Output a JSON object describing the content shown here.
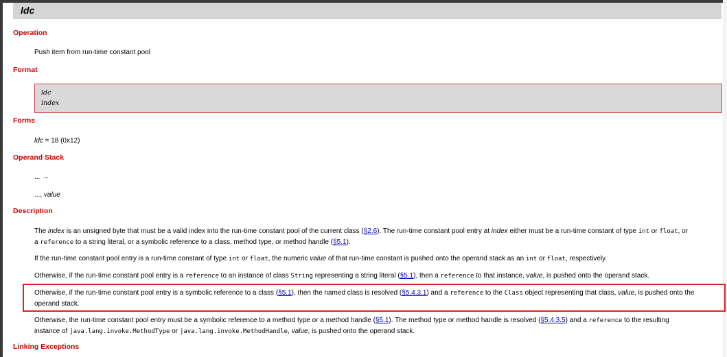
{
  "title": "ldc",
  "operation": {
    "heading": "Operation",
    "text": "Push item from run-time constant pool"
  },
  "format": {
    "heading": "Format",
    "lines": [
      "ldc",
      "index"
    ]
  },
  "forms": {
    "heading": "Forms",
    "name": "ldc",
    "value": " = 18 (0x12)"
  },
  "operand_stack": {
    "heading": "Operand Stack",
    "before": "... →",
    "after_prefix": "..., ",
    "after_value": "value"
  },
  "description": {
    "heading": "Description",
    "p1": {
      "t1": "The ",
      "index": "index",
      "t2": " is an unsigned byte that must be a valid index into the run-time constant pool of the current class (",
      "link1": "§2.6",
      "t3": "). The run-time constant pool entry at ",
      "index2": "index",
      "t4": " either must be a run-time constant of type ",
      "int": "int",
      "t5": " or ",
      "float": "float",
      "t6": ", or",
      "t7": "a ",
      "reference": "reference",
      "t8": " to a string literal, or a symbolic reference to a class, method type, or method handle (",
      "link2": "§5.1",
      "t9": ")."
    },
    "p2": {
      "t1": "If the run-time constant pool entry is a run-time constant of type ",
      "int": "int",
      "t2": " or ",
      "float": "float",
      "t3": ", the numeric ",
      "value": "value",
      "t4": " of that run-time constant is pushed onto the operand stack as an ",
      "int2": "int",
      "t5": " or ",
      "float2": "float",
      "t6": ", respectively."
    },
    "p3": {
      "t1": "Otherwise, if the run-time constant pool entry is a ",
      "reference": "reference",
      "t2": " to an instance of class ",
      "string": "String",
      "t3": " representing a string literal (",
      "link": "§5.1",
      "t4": "), then a ",
      "reference2": "reference",
      "t5": " to that instance, ",
      "value": "value",
      "t6": ", is pushed onto the operand stack."
    },
    "p4": {
      "t1": "Otherwise, if the run-time constant pool entry is a symbolic reference to a class (",
      "link1": "§5.1",
      "t2": "), then the named class is resolved (",
      "link2": "§5.4.3.1",
      "t3": ") and a ",
      "reference": "reference",
      "t4": " to the ",
      "class": "Class",
      "t5": " object representing that class, ",
      "value": "value",
      "t6": ", is pushed onto the",
      "t7": "operand stack."
    },
    "p5": {
      "t1": "Otherwise, the run-time constant pool entry must be a symbolic reference to a method type or a method handle (",
      "link1": "§5.1",
      "t2": "). The method type or method handle is resolved (",
      "link2": "§5.4.3.5",
      "t3": ") and a ",
      "reference": "reference",
      "t4": " to the resulting",
      "t5": "instance of ",
      "mt": "java.lang.invoke.MethodType",
      "t6": " or ",
      "mh": "java.lang.invoke.MethodHandle",
      "t7": ", ",
      "value": "value",
      "t8": ", is pushed onto the operand stack."
    }
  },
  "linking": {
    "heading": "Linking Exceptions"
  }
}
